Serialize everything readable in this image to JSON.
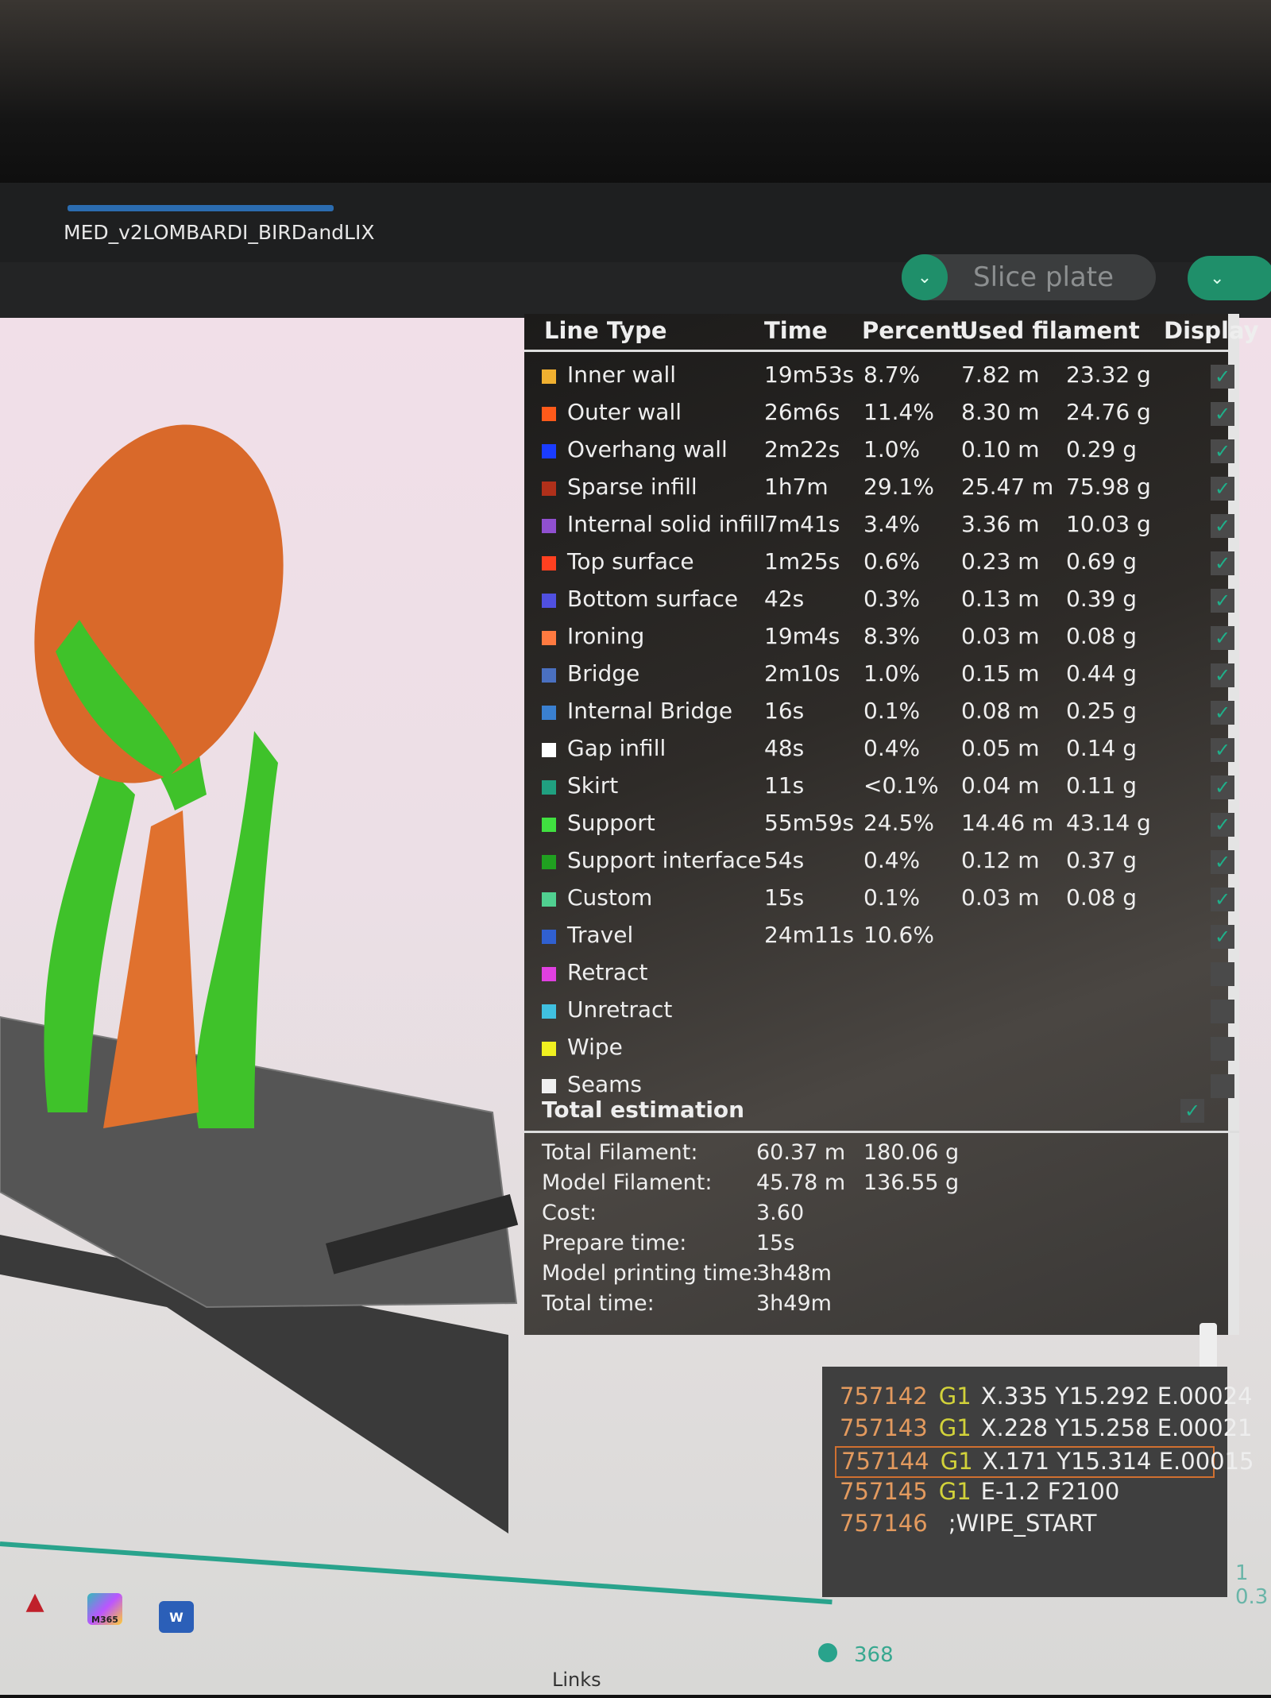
{
  "window": {
    "tab_title": "MED_v2LOMBARDI_BIRDandLIX"
  },
  "toolbar": {
    "slice_label": "Slice plate"
  },
  "legend": {
    "headers": {
      "line_type": "Line Type",
      "time": "Time",
      "percent": "Percent",
      "used_filament": "Used filament",
      "display": "Display"
    },
    "rows": [
      {
        "name": "Inner wall",
        "color": "#f0b030",
        "time": "19m53s",
        "percent": "8.7%",
        "length": "7.82 m",
        "weight": "23.32 g",
        "display": true
      },
      {
        "name": "Outer wall",
        "color": "#ff5a1a",
        "time": "26m6s",
        "percent": "11.4%",
        "length": "8.30 m",
        "weight": "24.76 g",
        "display": true
      },
      {
        "name": "Overhang wall",
        "color": "#1a3cff",
        "time": "2m22s",
        "percent": "1.0%",
        "length": "0.10 m",
        "weight": "0.29 g",
        "display": true
      },
      {
        "name": "Sparse infill",
        "color": "#b0301a",
        "time": "1h7m",
        "percent": "29.1%",
        "length": "25.47 m",
        "weight": "75.98 g",
        "display": true
      },
      {
        "name": "Internal solid infill",
        "color": "#9050d0",
        "time": "7m41s",
        "percent": "3.4%",
        "length": "3.36 m",
        "weight": "10.03 g",
        "display": true
      },
      {
        "name": "Top surface",
        "color": "#ff4020",
        "time": "1m25s",
        "percent": "0.6%",
        "length": "0.23 m",
        "weight": "0.69 g",
        "display": true
      },
      {
        "name": "Bottom surface",
        "color": "#5050e0",
        "time": "42s",
        "percent": "0.3%",
        "length": "0.13 m",
        "weight": "0.39 g",
        "display": true
      },
      {
        "name": "Ironing",
        "color": "#ff7a40",
        "time": "19m4s",
        "percent": "8.3%",
        "length": "0.03 m",
        "weight": "0.08 g",
        "display": true
      },
      {
        "name": "Bridge",
        "color": "#4a70c0",
        "time": "2m10s",
        "percent": "1.0%",
        "length": "0.15 m",
        "weight": "0.44 g",
        "display": true
      },
      {
        "name": "Internal Bridge",
        "color": "#3a80d0",
        "time": "16s",
        "percent": "0.1%",
        "length": "0.08 m",
        "weight": "0.25 g",
        "display": true
      },
      {
        "name": "Gap infill",
        "color": "#ffffff",
        "time": "48s",
        "percent": "0.4%",
        "length": "0.05 m",
        "weight": "0.14 g",
        "display": true
      },
      {
        "name": "Skirt",
        "color": "#20a080",
        "time": "11s",
        "percent": "<0.1%",
        "length": "0.04 m",
        "weight": "0.11 g",
        "display": true
      },
      {
        "name": "Support",
        "color": "#40e040",
        "time": "55m59s",
        "percent": "24.5%",
        "length": "14.46 m",
        "weight": "43.14 g",
        "display": true
      },
      {
        "name": "Support interface",
        "color": "#20a020",
        "time": "54s",
        "percent": "0.4%",
        "length": "0.12 m",
        "weight": "0.37 g",
        "display": true
      },
      {
        "name": "Custom",
        "color": "#50d090",
        "time": "15s",
        "percent": "0.1%",
        "length": "0.03 m",
        "weight": "0.08 g",
        "display": true
      },
      {
        "name": "Travel",
        "color": "#3060d0",
        "time": "24m11s",
        "percent": "10.6%",
        "length": "",
        "weight": "",
        "display": true
      },
      {
        "name": "Retract",
        "color": "#e040e0",
        "time": "",
        "percent": "",
        "length": "",
        "weight": "",
        "display": false
      },
      {
        "name": "Unretract",
        "color": "#40c0e0",
        "time": "",
        "percent": "",
        "length": "",
        "weight": "",
        "display": false
      },
      {
        "name": "Wipe",
        "color": "#f0f020",
        "time": "",
        "percent": "",
        "length": "",
        "weight": "",
        "display": false
      },
      {
        "name": "Seams",
        "color": "#f0f0f0",
        "time": "",
        "percent": "",
        "length": "",
        "weight": "",
        "display": false
      }
    ]
  },
  "total": {
    "title": "Total estimation",
    "display": true,
    "rows": [
      {
        "label": "Total Filament:",
        "v1": "60.37 m",
        "v2": "180.06 g"
      },
      {
        "label": "Model Filament:",
        "v1": "45.78 m",
        "v2": "136.55 g"
      },
      {
        "label": "Cost:",
        "v1": "3.60",
        "v2": ""
      },
      {
        "label": "Prepare time:",
        "v1": "15s",
        "v2": ""
      },
      {
        "label": "Model printing time:",
        "v1": "3h48m",
        "v2": ""
      },
      {
        "label": "Total time:",
        "v1": "3h49m",
        "v2": ""
      }
    ]
  },
  "gcode": [
    {
      "line": "757142",
      "cmd": "G1",
      "args": "X.335 Y15.292 E.00024",
      "selected": false
    },
    {
      "line": "757143",
      "cmd": "G1",
      "args": "X.228 Y15.258 E.00021",
      "selected": false
    },
    {
      "line": "757144",
      "cmd": "G1",
      "args": "X.171 Y15.314 E.00015",
      "selected": true
    },
    {
      "line": "757145",
      "cmd": "G1",
      "args": "E-1.2 F2100",
      "selected": false
    },
    {
      "line": "757146",
      "cmd": "",
      "args": ";WIPE_START",
      "selected": false
    }
  ],
  "slider": {
    "layer": "368",
    "layer_right_top": "1",
    "layer_right_height": "0.3"
  },
  "taskbar": {
    "m365_label": "M365",
    "word_label": "W",
    "links_label": "Links"
  }
}
